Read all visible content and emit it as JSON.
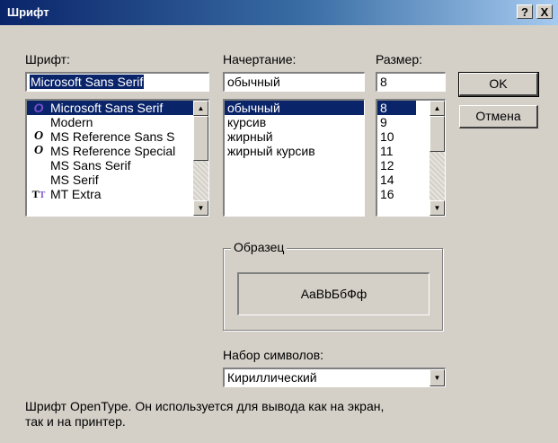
{
  "window": {
    "title": "Шрифт",
    "help_label": "?",
    "close_label": "X"
  },
  "font": {
    "label": "Шрифт:",
    "value": "Microsoft Sans Serif",
    "items": [
      {
        "label": "Microsoft Sans Serif",
        "icon": "opentype-icon",
        "selected": true
      },
      {
        "label": "Modern",
        "icon": "",
        "selected": false
      },
      {
        "label": "MS Reference Sans S",
        "icon": "opentype-icon",
        "selected": false
      },
      {
        "label": "MS Reference Special",
        "icon": "opentype-icon",
        "selected": false
      },
      {
        "label": "MS Sans Serif",
        "icon": "",
        "selected": false
      },
      {
        "label": "MS Serif",
        "icon": "",
        "selected": false
      },
      {
        "label": "MT Extra",
        "icon": "truetype-icon",
        "selected": false
      }
    ]
  },
  "style": {
    "label": "Начертание:",
    "value": "обычный",
    "items": [
      "обычный",
      "курсив",
      "жирный",
      "жирный курсив"
    ],
    "selected_index": 0
  },
  "size": {
    "label": "Размер:",
    "value": "8",
    "items": [
      "8",
      "9",
      "10",
      "11",
      "12",
      "14",
      "16"
    ],
    "selected_index": 0
  },
  "buttons": {
    "ok": "OK",
    "cancel": "Отмена"
  },
  "sample": {
    "title": "Образец",
    "text": "AaBbБбФф"
  },
  "charset": {
    "label": "Набор символов:",
    "value": "Кириллический"
  },
  "description": {
    "line1": "Шрифт OpenType. Он используется для вывода как на экран,",
    "line2": "так и на принтер."
  },
  "colors": {
    "title_bar": "#0a246a",
    "selection": "#0a246a",
    "face": "#d4d0c8"
  }
}
